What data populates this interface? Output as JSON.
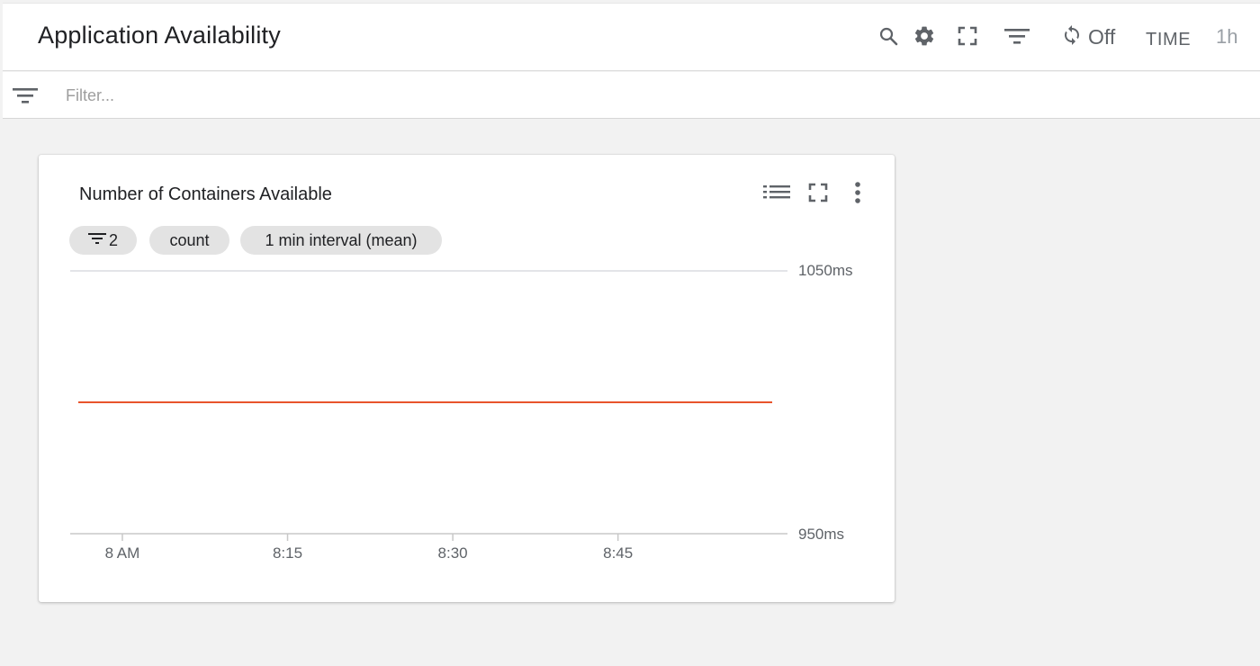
{
  "header": {
    "title": "Application Availability",
    "icons": [
      "search-icon",
      "gear-icon",
      "fullscreen-icon",
      "filter-icon",
      "refresh-icon"
    ],
    "refresh_label": "Off",
    "time_label": "TIME",
    "range_label": "1h"
  },
  "filter_bar": {
    "icon": "filter-icon",
    "placeholder": "Filter..."
  },
  "card": {
    "title": "Number of Containers Available",
    "icons": [
      "legend-list-icon",
      "fullscreen-icon",
      "more-vert-icon"
    ],
    "chips": {
      "filter_count": "2",
      "aggregation": "count",
      "interval": "1 min interval (mean)"
    }
  },
  "colors": {
    "series_line": "#e8542c",
    "grid": "#dadce0",
    "icon": "#5f6368"
  },
  "chart_data": {
    "type": "line",
    "title": "",
    "xlabel": "",
    "ylabel": "",
    "x_ticks": [
      "8 AM",
      "8:15",
      "8:30",
      "8:45"
    ],
    "y_ticks": [
      "1050ms",
      "950ms"
    ],
    "ylim": [
      950,
      1050
    ],
    "xlim": [
      "7:56",
      "8:59"
    ],
    "series": [
      {
        "x": [
          "7:56",
          "8:59"
        ],
        "values": [
          1000,
          1000
        ]
      }
    ],
    "grid": true,
    "legend": "none"
  }
}
